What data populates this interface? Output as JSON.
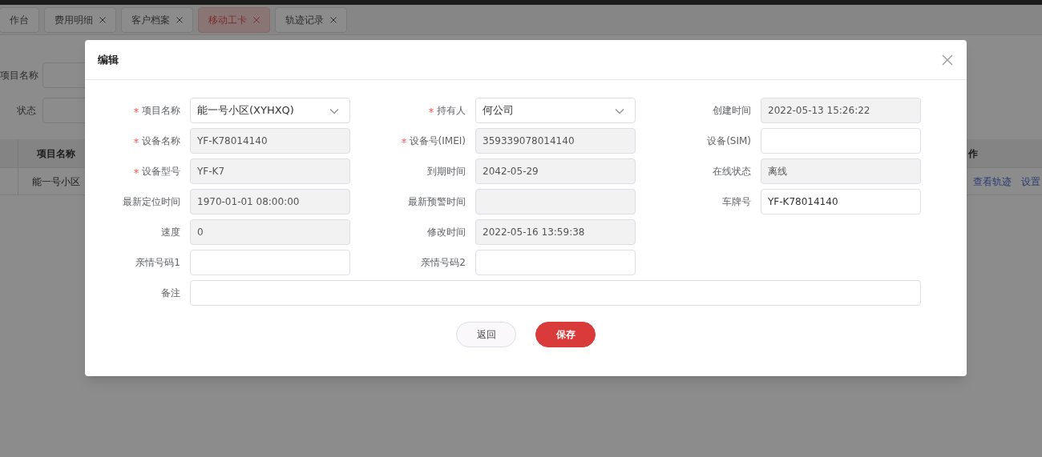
{
  "tabs": [
    {
      "label": "作台",
      "closable": false,
      "selected": false
    },
    {
      "label": "费用明细",
      "closable": true,
      "selected": false
    },
    {
      "label": "客户档案",
      "closable": true,
      "selected": false
    },
    {
      "label": "移动工卡",
      "closable": true,
      "selected": true
    },
    {
      "label": "轨迹记录",
      "closable": true,
      "selected": false
    }
  ],
  "filters": [
    {
      "label": "项目名称"
    },
    {
      "label": "状态"
    }
  ],
  "table": {
    "columns": [
      "项目名称",
      "作"
    ],
    "rows": [
      {
        "project": "能一号小区",
        "actions": [
          "查看轨迹",
          "设置"
        ]
      }
    ]
  },
  "dialog": {
    "title": "编辑",
    "fields": [
      {
        "label": "项目名称",
        "required": true,
        "kind": "select",
        "value": "能一号小区(XYHXQ)"
      },
      {
        "label": "持有人",
        "required": true,
        "kind": "select",
        "value": "何公司"
      },
      {
        "label": "创建时间",
        "required": false,
        "kind": "readonly",
        "value": "2022-05-13 15:26:22"
      },
      {
        "label": "设备名称",
        "required": true,
        "kind": "readonly",
        "value": "YF-K78014140"
      },
      {
        "label": "设备号(IMEI)",
        "required": true,
        "kind": "readonly",
        "value": "359339078014140"
      },
      {
        "label": "设备(SIM)",
        "required": false,
        "kind": "text"
      },
      {
        "label": "设备型号",
        "required": true,
        "kind": "readonly",
        "value": "YF-K7"
      },
      {
        "label": "到期时间",
        "required": false,
        "kind": "readonly",
        "value": "2042-05-29"
      },
      {
        "label": "在线状态",
        "required": false,
        "kind": "readonly",
        "value": "离线"
      },
      {
        "label": "最新定位时间",
        "required": false,
        "kind": "readonly",
        "value": "1970-01-01 08:00:00"
      },
      {
        "label": "最新预警时间",
        "required": false,
        "kind": "readonly"
      },
      {
        "label": "车牌号",
        "required": false,
        "kind": "text",
        "value": "YF-K78014140"
      },
      {
        "label": "速度",
        "required": false,
        "kind": "readonly",
        "value": "0"
      },
      {
        "label": "修改时间",
        "required": false,
        "kind": "readonly",
        "value": "2022-05-16 13:59:38"
      },
      {
        "kind": "empty"
      },
      {
        "label": "亲情号码1",
        "required": false,
        "kind": "text"
      },
      {
        "label": "亲情号码2",
        "required": false,
        "kind": "text"
      },
      {
        "kind": "empty"
      }
    ],
    "remark": {
      "label": "备注"
    },
    "buttons": [
      {
        "label": "返回",
        "kind": "secondary"
      },
      {
        "label": "保存",
        "kind": "primary"
      }
    ]
  }
}
